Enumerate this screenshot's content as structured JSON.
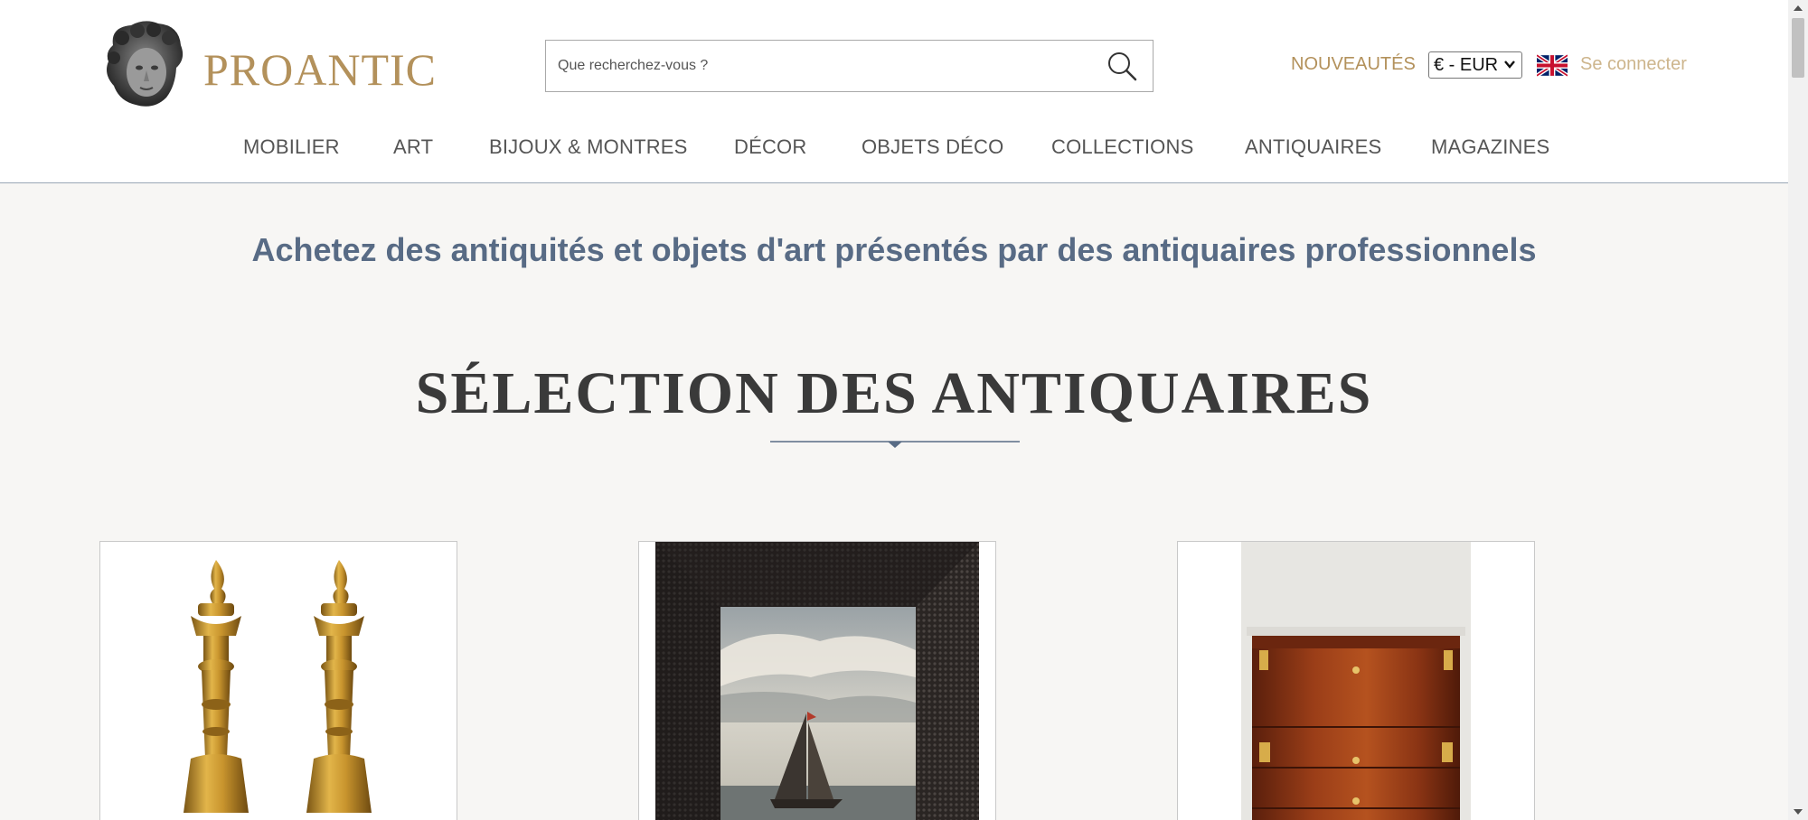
{
  "logo": {
    "text": "PROANTIC"
  },
  "search": {
    "placeholder": "Que recherchez-vous ?"
  },
  "header_links": {
    "new_label": "NOUVEAUTÉS",
    "currency": "€ - EUR",
    "signin_label": "Se connecter"
  },
  "nav": {
    "items": [
      "MOBILIER",
      "ART",
      "BIJOUX & MONTRES",
      "DÉCOR",
      "OBJETS DÉCO",
      "COLLECTIONS",
      "ANTIQUAIRES",
      "MAGAZINES"
    ]
  },
  "main": {
    "tagline": "Achetez des antiquités et objets d'art présentés par des antiquaires professionnels",
    "section_title": "SÉLECTION DES ANTIQUAIRES"
  },
  "colors": {
    "brand_gold": "#b3915b",
    "accent_blue": "#586b85",
    "background": "#f7f6f4"
  },
  "icons": [
    "search-icon",
    "flag-uk-icon",
    "chevron-down-icon"
  ]
}
